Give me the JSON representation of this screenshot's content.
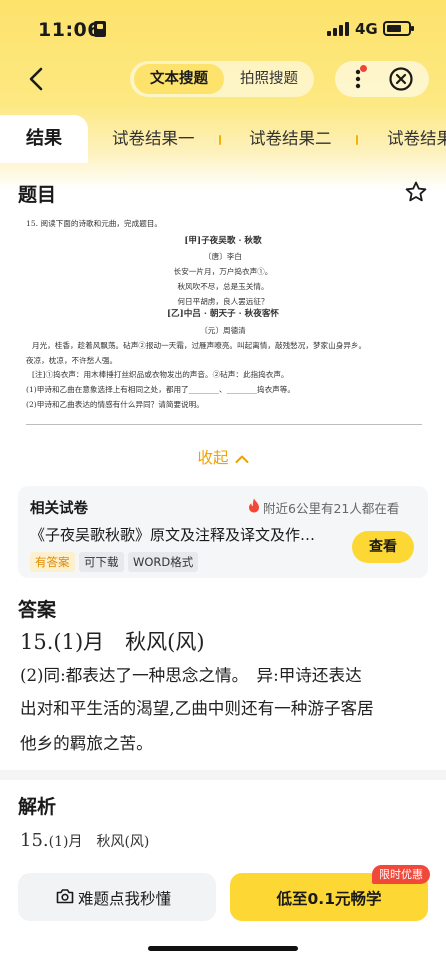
{
  "status_bar": {
    "time": "11:06",
    "network": "4G"
  },
  "nav": {
    "mode_tabs": [
      {
        "label": "文本搜题",
        "active": true
      },
      {
        "label": "拍照搜题",
        "active": false
      }
    ]
  },
  "result_tabs": [
    {
      "label": "结果",
      "active": true
    },
    {
      "label": "试卷结果一",
      "active": false
    },
    {
      "label": "试卷结果二",
      "active": false
    },
    {
      "label": "试卷结果",
      "active": false
    }
  ],
  "question": {
    "section_title": "题目",
    "lines": [
      "15. 阅读下面的诗歌和元曲，完成题目。",
      "[甲]子夜吴歌 · 秋歌",
      "〔唐〕李白",
      "长安一片月，万户捣衣声①。",
      "秋风吹不尽，总是玉关情。",
      "何日平胡虏，良人罢远征？",
      "[乙]中吕 · 朝天子 · 秋夜客怀",
      "〔元〕周德清",
      "月光，桂香，趁着风飘荡。砧声②报动一天霜，过雁声嘹亮。叫起离情，敲残愁况，梦家山身异乡。",
      "夜凉，枕凉，不许愁人强。",
      "[注]①捣衣声：用木棒捶打丝织品或衣物发出的声音。②砧声：此指捣衣声。",
      "(1)甲诗和乙曲在意象选择上有相同之处，都用了________、________捣衣声等。",
      "(2)甲诗和乙曲表达的情感有什么异同？请简要说明。"
    ],
    "collapse_label": "收起"
  },
  "related": {
    "title": "相关试卷",
    "nearby": "附近6公里有21人都在看",
    "paper_name": "《子夜吴歌秋歌》原文及注释及译文及作…",
    "tags": [
      "有答案",
      "可下载",
      "WORD格式"
    ],
    "view_label": "查看"
  },
  "answer": {
    "section_title": "答案",
    "lines": [
      "15.(1)月　秋风(风)",
      "(2)同:都表达了一种思念之情。　异:甲诗还表达",
      "出对和平生活的渴望,乙曲中则还有一种游子客居",
      "他乡的羁旅之苦。"
    ]
  },
  "analysis": {
    "section_title": "解析",
    "number": "15.",
    "text": "(1)月　秋风(风)"
  },
  "bottom": {
    "help_label": "难题点我秒懂",
    "buy_label": "低至0.1元畅学",
    "promo_badge": "限时优惠"
  },
  "colors": {
    "brand_yellow": "#fdd835",
    "accent_orange": "#f0a300",
    "promo_red": "#f2483a"
  }
}
